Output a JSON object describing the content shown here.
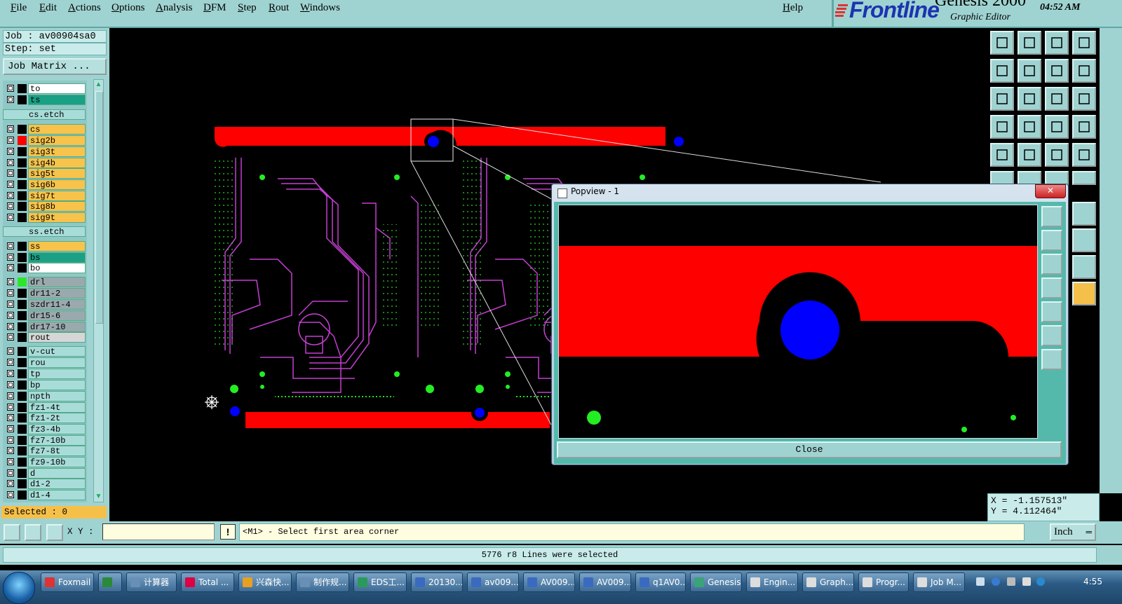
{
  "menu": [
    "File",
    "Edit",
    "Actions",
    "Options",
    "Analysis",
    "DFM",
    "Step",
    "Rout",
    "Windows"
  ],
  "help": "Help",
  "brand": {
    "logo": "Frontline",
    "product": "Genesis 2000",
    "subtitle": "Graphic Editor",
    "time": "04:52  AM"
  },
  "job": {
    "job_line": "Job : av00904sa0",
    "step_line": "Step: set",
    "matrix_button": "Job Matrix ..."
  },
  "layers": [
    {
      "name": "to",
      "color": "#ffffff",
      "swatch": "#000000"
    },
    {
      "name": "ts",
      "color": "#1aa085",
      "swatch": "#000000"
    },
    {
      "name": "cs.etch",
      "color": "#a8dcd9",
      "swatch": null
    },
    {
      "name": "cs",
      "color": "#f7c34b",
      "swatch": "#000000"
    },
    {
      "name": "sig2b",
      "color": "#f7c34b",
      "swatch": "#ff0000"
    },
    {
      "name": "sig3t",
      "color": "#f7c34b",
      "swatch": "#000000"
    },
    {
      "name": "sig4b",
      "color": "#f7c34b",
      "swatch": "#000000"
    },
    {
      "name": "sig5t",
      "color": "#f7c34b",
      "swatch": "#000000"
    },
    {
      "name": "sig6b",
      "color": "#f7c34b",
      "swatch": "#000000"
    },
    {
      "name": "sig7t",
      "color": "#f7c34b",
      "swatch": "#000000"
    },
    {
      "name": "sig8b",
      "color": "#f7c34b",
      "swatch": "#000000"
    },
    {
      "name": "sig9t",
      "color": "#f7c34b",
      "swatch": "#000000"
    },
    {
      "name": "ss.etch",
      "color": "#a8dcd9",
      "swatch": null
    },
    {
      "name": "ss",
      "color": "#f7c34b",
      "swatch": "#000000"
    },
    {
      "name": "bs",
      "color": "#1aa085",
      "swatch": "#000000"
    },
    {
      "name": "bo",
      "color": "#ffffff",
      "swatch": "#000000"
    },
    {
      "name": "drl",
      "color": "#9aa9ad",
      "swatch": "#2ce62c"
    },
    {
      "name": "dr11-2",
      "color": "#9aa9ad",
      "swatch": "#000000"
    },
    {
      "name": "szdr11-4",
      "color": "#9aa9ad",
      "swatch": "#000000"
    },
    {
      "name": "dr15-6",
      "color": "#9aa9ad",
      "swatch": "#000000"
    },
    {
      "name": "dr17-10",
      "color": "#9aa9ad",
      "swatch": "#000000"
    },
    {
      "name": "rout",
      "color": "#d6d6d6",
      "swatch": "#000000"
    },
    {
      "name": "v-cut",
      "color": "#a8dcd9",
      "swatch": "#000000"
    },
    {
      "name": "rou",
      "color": "#a8dcd9",
      "swatch": "#000000"
    },
    {
      "name": "tp",
      "color": "#a8dcd9",
      "swatch": "#000000"
    },
    {
      "name": "bp",
      "color": "#a8dcd9",
      "swatch": "#000000"
    },
    {
      "name": "npth",
      "color": "#a8dcd9",
      "swatch": "#000000"
    },
    {
      "name": "fz1-4t",
      "color": "#a8dcd9",
      "swatch": "#000000"
    },
    {
      "name": "fz1-2t",
      "color": "#a8dcd9",
      "swatch": "#000000"
    },
    {
      "name": "fz3-4b",
      "color": "#a8dcd9",
      "swatch": "#000000"
    },
    {
      "name": "fz7-10b",
      "color": "#a8dcd9",
      "swatch": "#000000"
    },
    {
      "name": "fz7-8t",
      "color": "#a8dcd9",
      "swatch": "#000000"
    },
    {
      "name": "fz9-10b",
      "color": "#a8dcd9",
      "swatch": "#000000"
    },
    {
      "name": "d",
      "color": "#a8dcd9",
      "swatch": "#000000"
    },
    {
      "name": "d1-2",
      "color": "#a8dcd9",
      "swatch": "#000000"
    },
    {
      "name": "d1-4",
      "color": "#a8dcd9",
      "swatch": "#000000"
    }
  ],
  "selected": "Selected : 0",
  "coords": {
    "x": "X = -1.157513\"",
    "y": "Y =  4.112464\""
  },
  "cmd": {
    "xy_label": "X Y :",
    "xy_value": "",
    "prompt": "<M1> - Select first area corner",
    "units": "Inch"
  },
  "status": "5776 r8 Lines were selected",
  "popview": {
    "title": "Popview - 1",
    "close": "Close"
  },
  "taskbar": {
    "items": [
      {
        "label": "Foxmail",
        "icon": "#d33"
      },
      {
        "label": "",
        "icon": "#2a8a3a"
      },
      {
        "label": "计算器",
        "icon": "#6a8fb5"
      },
      {
        "label": "Total ...",
        "icon": "#d04"
      },
      {
        "label": "兴森快...",
        "icon": "#e9a020"
      },
      {
        "label": "制作规...",
        "icon": "#6a8fb5"
      },
      {
        "label": "EDS工...",
        "icon": "#2a9a5a"
      },
      {
        "label": "20130...",
        "icon": "#3a6ac0"
      },
      {
        "label": "av009...",
        "icon": "#3a6ac0"
      },
      {
        "label": "AV009...",
        "icon": "#3a6ac0"
      },
      {
        "label": "AV009...",
        "icon": "#3a6ac0"
      },
      {
        "label": "q1AV0...",
        "icon": "#3a6ac0"
      },
      {
        "label": "Genesis",
        "icon": "#3aa37a"
      },
      {
        "label": "Engin...",
        "icon": "#ddd"
      },
      {
        "label": "Graph...",
        "icon": "#ddd"
      },
      {
        "label": "Progr...",
        "icon": "#ddd"
      },
      {
        "label": "Job M...",
        "icon": "#ddd"
      }
    ],
    "clock": "4:55"
  },
  "icons": [
    "home-up-icon",
    "home-down-icon",
    "home-icon",
    "frame-icon",
    "zoom-left-icon",
    "zoom-right-icon",
    "zoom-back-icon",
    "zoom-redraw-icon",
    "fit-icon",
    "center-icon",
    "ratio-icon",
    "help-icon",
    "tool-icon",
    "grid-icon",
    "route-icon",
    "route-2-icon",
    "select-icon",
    "snap-icon",
    "ruler-icon",
    "circle-icon"
  ]
}
